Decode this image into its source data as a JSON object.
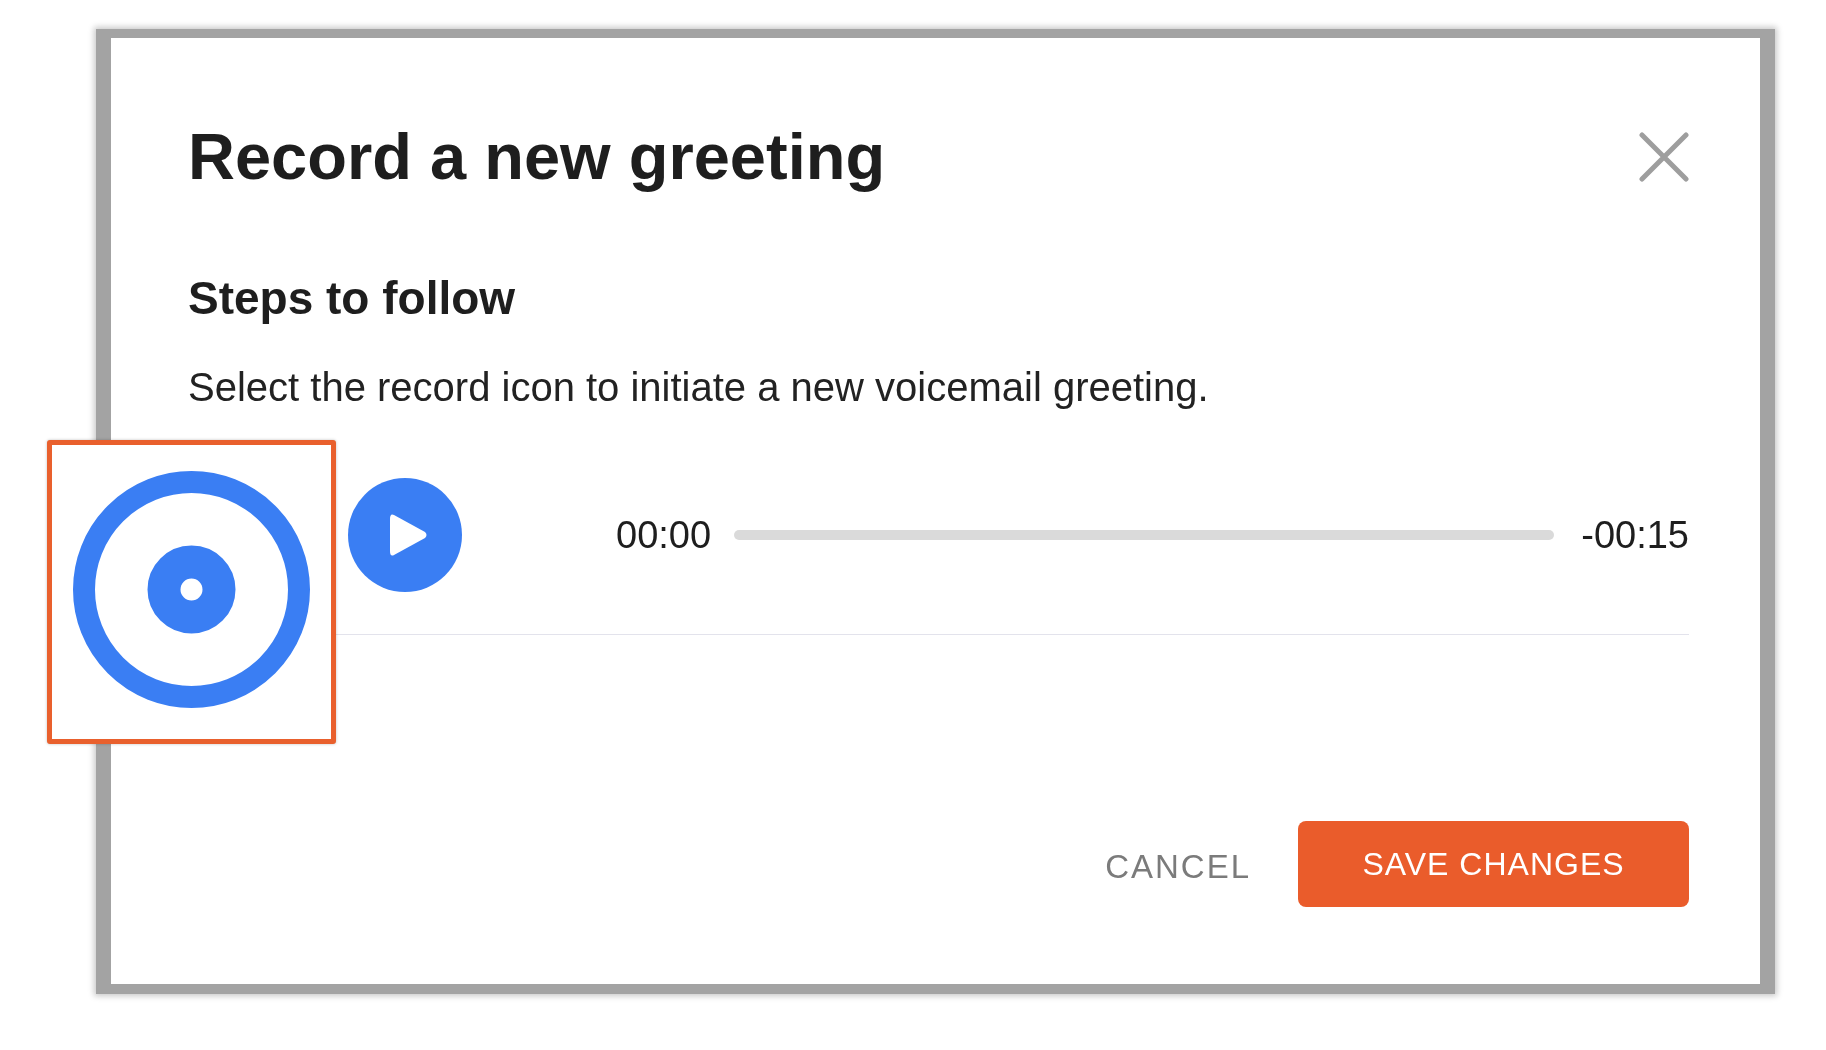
{
  "dialog": {
    "title": "Record a new greeting"
  },
  "steps": {
    "heading": "Steps to follow",
    "text": "Select the record icon to initiate a new voicemail greeting."
  },
  "player": {
    "elapsed": "00:00",
    "remaining": "-00:15"
  },
  "buttons": [
    {
      "label": "CANCEL",
      "kind": "text"
    },
    {
      "label": "SAVE CHANGES",
      "kind": "primary"
    }
  ]
}
